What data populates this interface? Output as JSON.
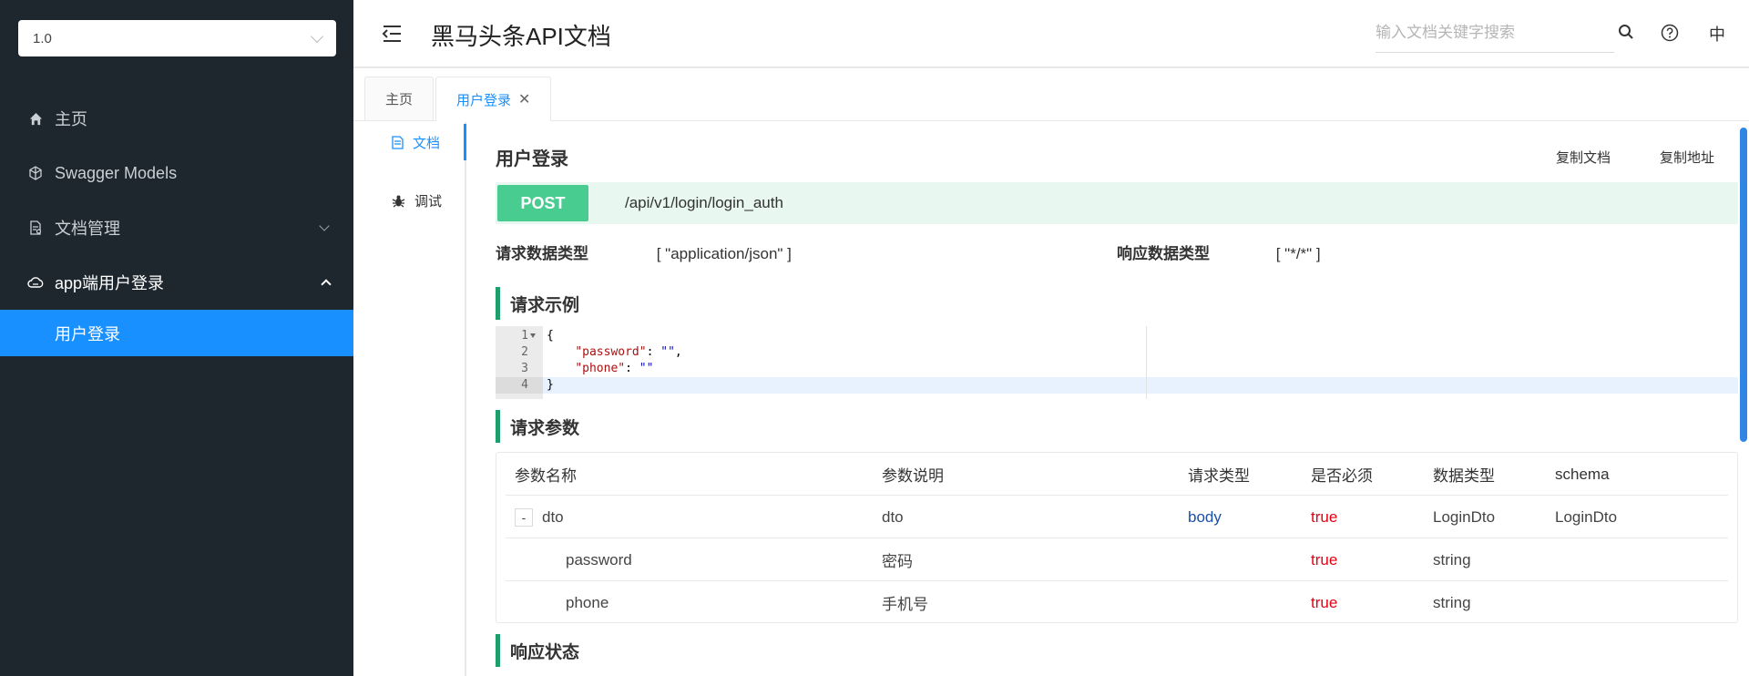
{
  "sidebar": {
    "version": "1.0",
    "menu": [
      {
        "label": "主页",
        "icon": "home-icon"
      },
      {
        "label": "Swagger Models",
        "icon": "models-icon"
      },
      {
        "label": "文档管理",
        "icon": "doc-manage-icon"
      },
      {
        "label": "app端用户登录",
        "icon": "cloud-icon"
      }
    ],
    "submenu_active": "用户登录"
  },
  "header": {
    "title": "黑马头条API文档",
    "search_placeholder": "输入文档关键字搜索",
    "lang": "中"
  },
  "tabs": [
    {
      "label": "主页"
    },
    {
      "label": "用户登录",
      "active": true
    }
  ],
  "docnav": {
    "doc_label": "文档",
    "debug_label": "调试"
  },
  "api": {
    "title": "用户登录",
    "copy_doc": "复制文档",
    "copy_addr": "复制地址",
    "method": "POST",
    "path": "/api/v1/login/login_auth",
    "req_type_label": "请求数据类型",
    "req_type_value": "[ \"application/json\" ]",
    "resp_type_label": "响应数据类型",
    "resp_type_value": "[ \"*/*\" ]",
    "method_color": "#49cc90"
  },
  "sections": {
    "request_example": "请求示例",
    "request_params": "请求参数",
    "response_status": "响应状态"
  },
  "code": {
    "line_numbers": [
      "1",
      "2",
      "3",
      "4"
    ],
    "l1": "{",
    "l2_key": "\"password\"",
    "l2_rest": ": ",
    "l2_val": "\"\"",
    "l2_end": ",",
    "l3_key": "\"phone\"",
    "l3_rest": ": ",
    "l3_val": "\"\"",
    "l4": "}"
  },
  "params_table": {
    "headers": [
      "参数名称",
      "参数说明",
      "请求类型",
      "是否必须",
      "数据类型",
      "schema"
    ],
    "rows": [
      {
        "expander": "-",
        "name": "dto",
        "desc": "dto",
        "in": "body",
        "required": "true",
        "type": "LoginDto",
        "schema": "LoginDto"
      },
      {
        "name": "password",
        "desc": "密码",
        "in": "",
        "required": "true",
        "type": "string",
        "schema": ""
      },
      {
        "name": "phone",
        "desc": "手机号",
        "in": "",
        "required": "true",
        "type": "string",
        "schema": ""
      }
    ]
  }
}
